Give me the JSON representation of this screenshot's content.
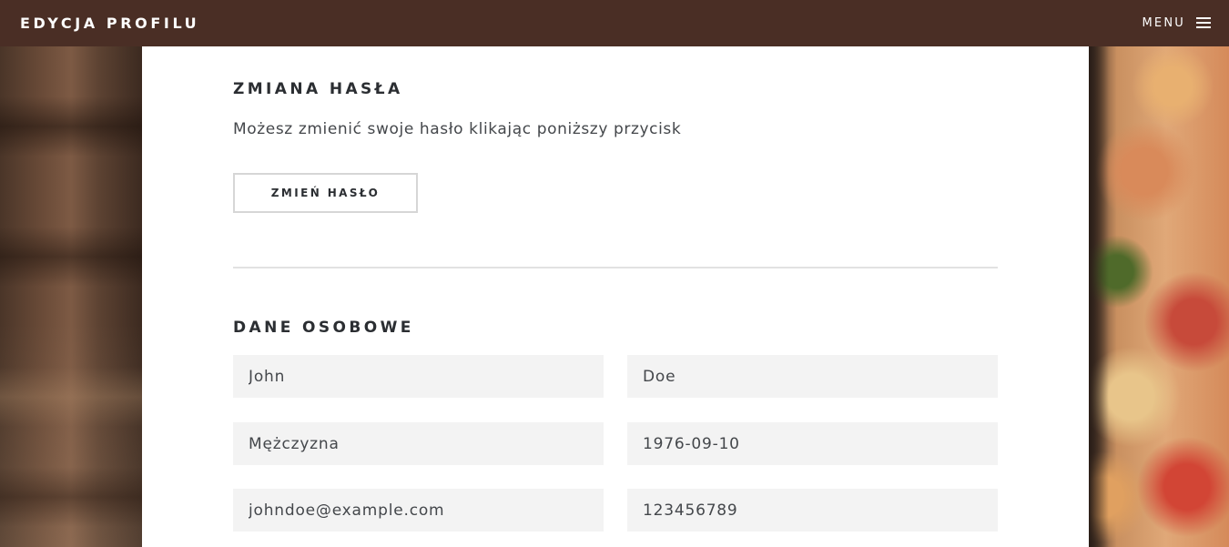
{
  "header": {
    "title": "EDYCJA PROFILU",
    "menu_label": "MENU",
    "menu_icon": "hamburger-icon"
  },
  "password_section": {
    "title": "ZMIANA HASŁA",
    "description": "Możesz zmienić swoje hasło klikając poniższy przycisk",
    "button_label": "ZMIEŃ HASŁO"
  },
  "personal_section": {
    "title": "DANE OSOBOWE",
    "fields": {
      "first_name": "John",
      "last_name": "Doe",
      "gender": "Mężczyzna",
      "birth_date": "1976-09-10",
      "email": "johndoe@example.com",
      "phone": "123456789"
    }
  },
  "colors": {
    "header_bg": "#4a2e25",
    "panel_bg": "#ffffff",
    "input_bg": "#f3f3f3",
    "text_dark": "#2b2e32"
  }
}
